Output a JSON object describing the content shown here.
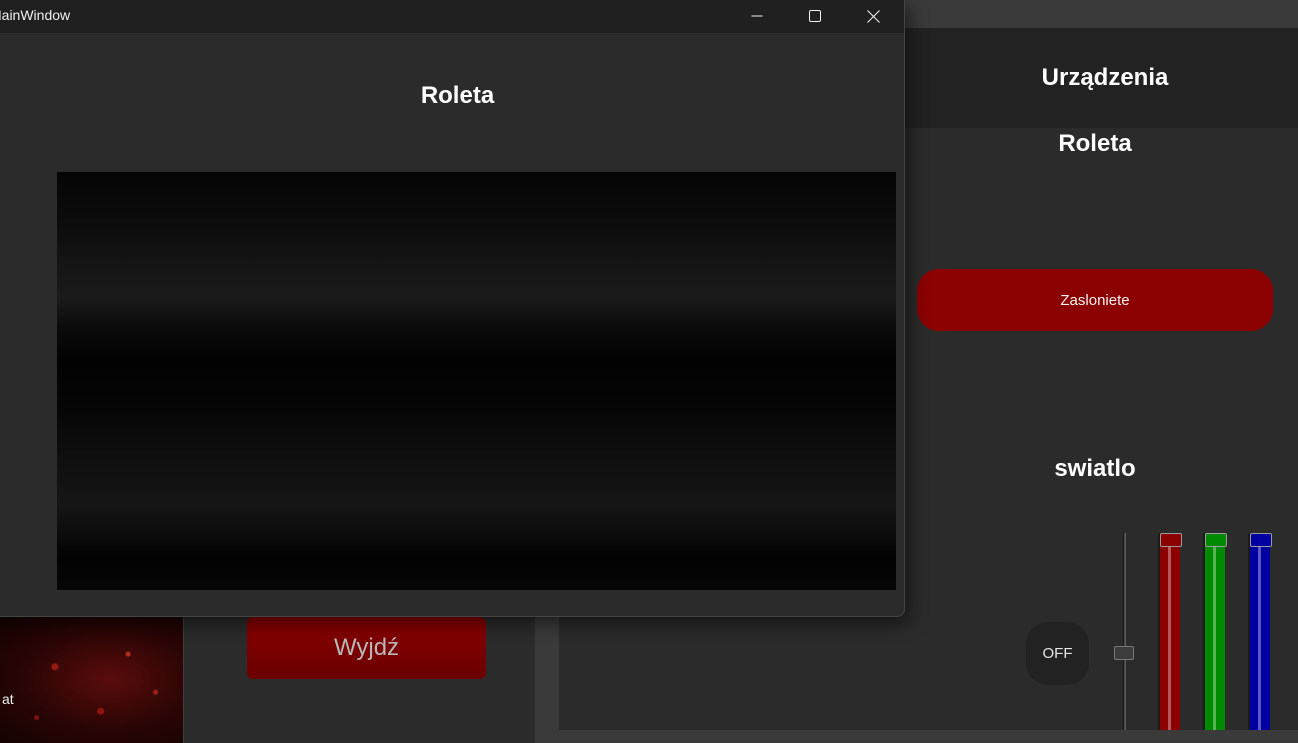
{
  "background_app": {
    "header_title": "Urządzenia",
    "roleta_title": "Roleta",
    "roleta_button": "Zasloniete",
    "swiatlo_title": "swiatlo",
    "off_button": "OFF",
    "exit_button": "Wyjdź",
    "image_tile_label": "at",
    "colors": {
      "accent_red": "#8b0000",
      "slider_red": "#8b0000",
      "slider_green": "#008a00",
      "slider_blue": "#0000a0"
    },
    "brightness_level": 0.38,
    "rgb_levels": {
      "red": 1.0,
      "green": 1.0,
      "blue": 1.0
    }
  },
  "window": {
    "title": "MainWindow",
    "heading": "Roleta",
    "controls": {
      "minimize_icon": "minimize-icon",
      "maximize_icon": "maximize-icon",
      "close_icon": "close-icon"
    }
  }
}
